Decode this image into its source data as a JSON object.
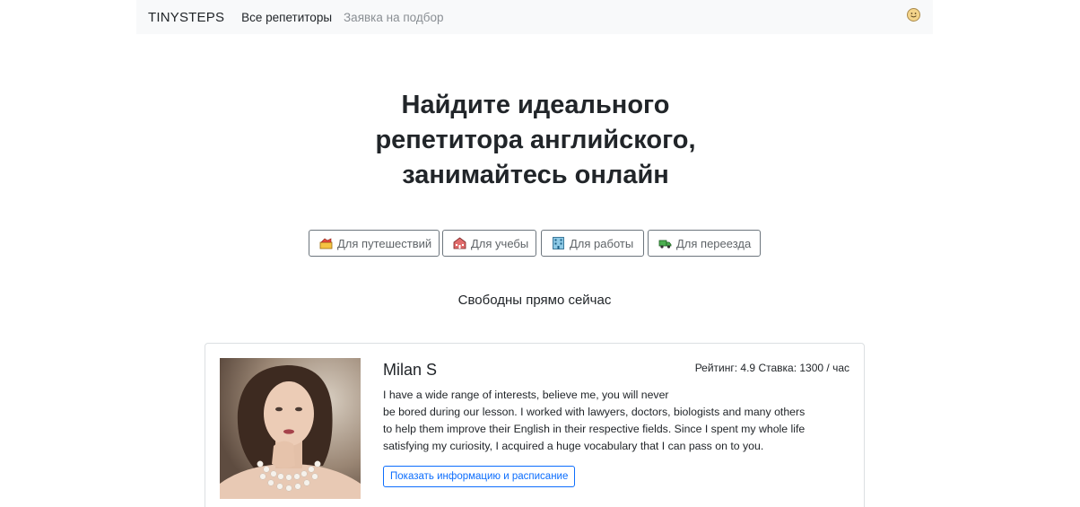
{
  "navbar": {
    "brand": "TINYSTEPS",
    "links": [
      {
        "label": "Все репетиторы",
        "active": true
      },
      {
        "label": "Заявка на подбор",
        "active": false
      }
    ],
    "avatar_icon": "smiley-face-icon"
  },
  "hero": {
    "lines": [
      "Найдите идеального",
      "репетитора английского,",
      "занимайтесь онлайн"
    ]
  },
  "goals": [
    {
      "label": "Для путешествий",
      "icon": "travel-icon"
    },
    {
      "label": "Для учебы",
      "icon": "school-icon"
    },
    {
      "label": "Для работы",
      "icon": "office-building-icon"
    },
    {
      "label": "Для переезда",
      "icon": "moving-truck-icon"
    }
  ],
  "available_heading": "Свободны прямо сейчас",
  "tutors": [
    {
      "name": "Milan S",
      "rating_line": "Рейтинг: 4.9 Ставка: 1300 / час",
      "bio_lines": [
        "I have a wide range of interests, believe me, you will never",
        "be bored during our lesson. I worked with lawyers, doctors, biologists and many others",
        "to help them improve their English in their respective fields. Since I spent my whole life",
        "satisfying my curiosity, I acquired a huge vocabulary that I can pass on to you."
      ],
      "button_label": "Показать информацию и расписание"
    }
  ],
  "colors": {
    "accent": "#0d6efd",
    "navbar_bg": "#f8f9fa",
    "muted_text": "#8a8f94"
  }
}
